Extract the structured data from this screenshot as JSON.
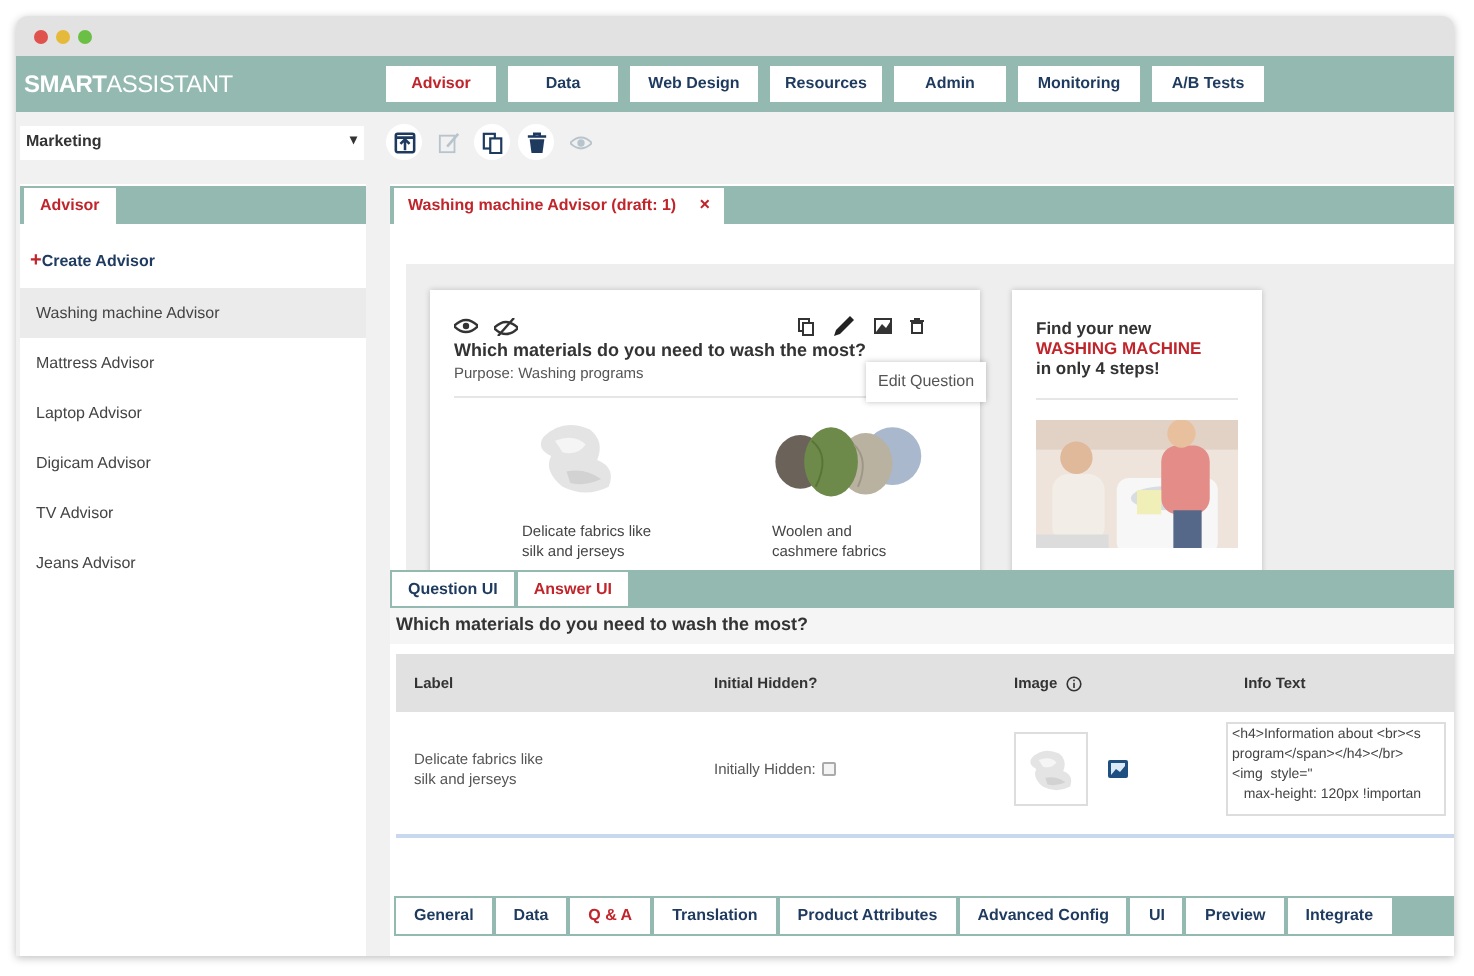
{
  "brand": {
    "strong": "SMART",
    "light": "ASSISTANT"
  },
  "nav": [
    {
      "label": "Advisor",
      "selected": true
    },
    {
      "label": "Data",
      "selected": false
    },
    {
      "label": "Web Design",
      "selected": false
    },
    {
      "label": "Resources",
      "selected": false
    },
    {
      "label": "Admin",
      "selected": false
    },
    {
      "label": "Monitoring",
      "selected": false
    },
    {
      "label": "A/B Tests",
      "selected": false
    }
  ],
  "project_select": {
    "value": "Marketing",
    "arrow": "▾"
  },
  "toolbar": [
    {
      "kind": "upload",
      "disabled": false
    },
    {
      "kind": "edit",
      "disabled": true
    },
    {
      "kind": "copy",
      "disabled": false
    },
    {
      "kind": "delete",
      "disabled": false
    },
    {
      "kind": "view",
      "disabled": true
    }
  ],
  "sidebar": {
    "tab": {
      "label": "Advisor",
      "selected": true
    },
    "create": {
      "icon": "+",
      "label": "Create Advisor"
    },
    "items": [
      {
        "label": "Washing machine Advisor",
        "selected": true
      },
      {
        "label": "Mattress Advisor",
        "selected": false
      },
      {
        "label": "Laptop Advisor",
        "selected": false
      },
      {
        "label": "Digicam Advisor",
        "selected": false
      },
      {
        "label": "TV Advisor",
        "selected": false
      },
      {
        "label": "Jeans Advisor",
        "selected": false
      }
    ]
  },
  "editor_tab": {
    "label": "Washing machine Advisor (draft: 1)",
    "close": "×"
  },
  "question_card": {
    "title": "Which materials do you need to wash the most?",
    "purpose": "Purpose: Washing programs",
    "tooltip": "Edit Question",
    "answers": [
      {
        "label": "Delicate fabrics like\nsilk and jerseys",
        "kind": "fabric"
      },
      {
        "label": "Woolen and\ncashmere fabrics",
        "kind": "yarn"
      }
    ]
  },
  "promo_card": {
    "line_1": "Find your new",
    "highlight": "WASHING MACHINE",
    "line_2": "in only 4 steps!",
    "kind": "picture"
  },
  "sub_tabs": [
    {
      "label": "Question UI",
      "selected": false
    },
    {
      "label": "Answer UI",
      "selected": true
    }
  ],
  "question_heading": "Which materials do you need to wash the most?",
  "table": {
    "columns": [
      "Label",
      "Initial Hidden?",
      "Image",
      "Info Text"
    ],
    "rows": [
      {
        "label": "Delicate fabrics like\nsilk and jerseys",
        "hidden_label": "Initially Hidden:",
        "checked": false,
        "info_text": "<h4>Information about <br><s\nprogram</span></h4></br>\n<img  style=\"\n   max-height: 120px !importan"
      }
    ]
  },
  "bottom_tabs": [
    {
      "label": "General",
      "selected": false
    },
    {
      "label": "Data",
      "selected": false
    },
    {
      "label": "Q & A",
      "selected": true
    },
    {
      "label": "Translation",
      "selected": false
    },
    {
      "label": "Product Attributes",
      "selected": false
    },
    {
      "label": "Advanced Config",
      "selected": false
    },
    {
      "label": "UI",
      "selected": false
    },
    {
      "label": "Preview",
      "selected": false
    },
    {
      "label": "Integrate",
      "selected": false
    }
  ]
}
